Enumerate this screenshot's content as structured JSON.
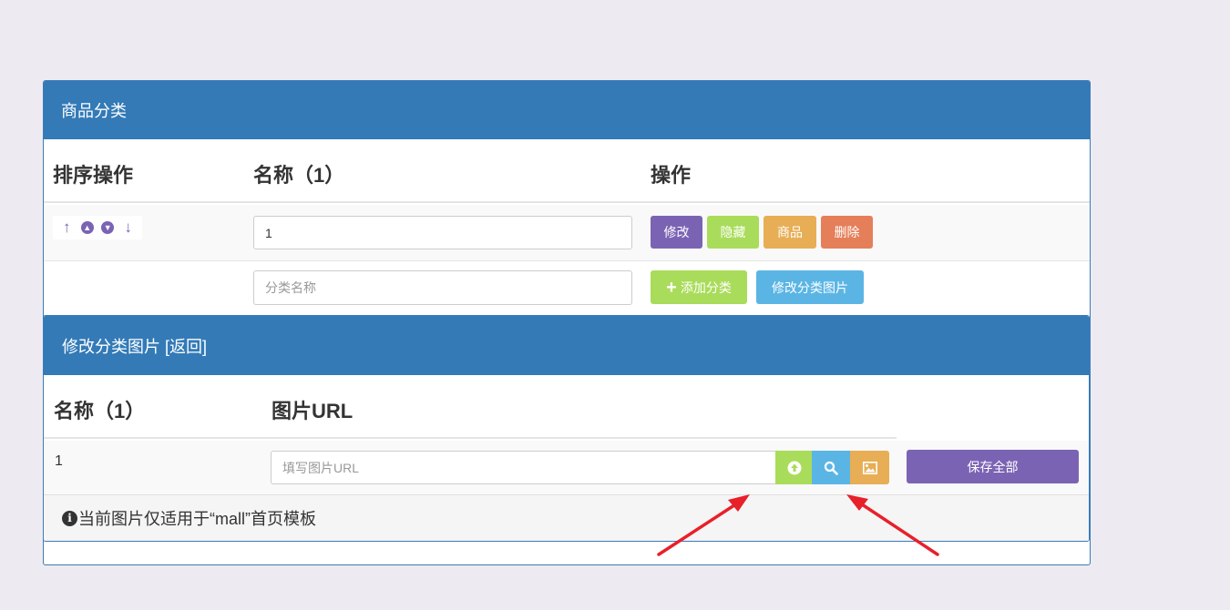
{
  "category_panel": {
    "title": "商品分类",
    "headers": {
      "sort": "排序操作",
      "name": "名称（1）",
      "actions": "操作"
    },
    "rows": [
      {
        "name_value": "1",
        "buttons": {
          "edit": "修改",
          "hide": "隐藏",
          "goods": "商品",
          "delete": "删除"
        }
      }
    ],
    "new_row": {
      "name_placeholder": "分类名称",
      "add_label": "添加分类",
      "edit_image_label": "修改分类图片"
    }
  },
  "image_panel": {
    "title": "修改分类图片 [返回]",
    "headers": {
      "name": "名称（1）",
      "url": "图片URL"
    },
    "rows": [
      {
        "name": "1",
        "url_placeholder": "填写图片URL"
      }
    ],
    "save_label": "保存全部",
    "note": "当前图片仅适用于“mall”首页模板"
  },
  "icons": [
    "arrow-up-icon",
    "chevron-up-icon",
    "chevron-down-icon",
    "arrow-down-icon",
    "plus-icon",
    "upload-icon",
    "search-icon",
    "image-icon",
    "info-icon"
  ],
  "colors": {
    "header": "#337ab7",
    "purple": "#7b63b4",
    "green": "#a9dc5a",
    "orange": "#e7ae55",
    "red": "#e57f5a",
    "blue": "#5bb5e4",
    "annotation_arrow": "#e8202a"
  }
}
